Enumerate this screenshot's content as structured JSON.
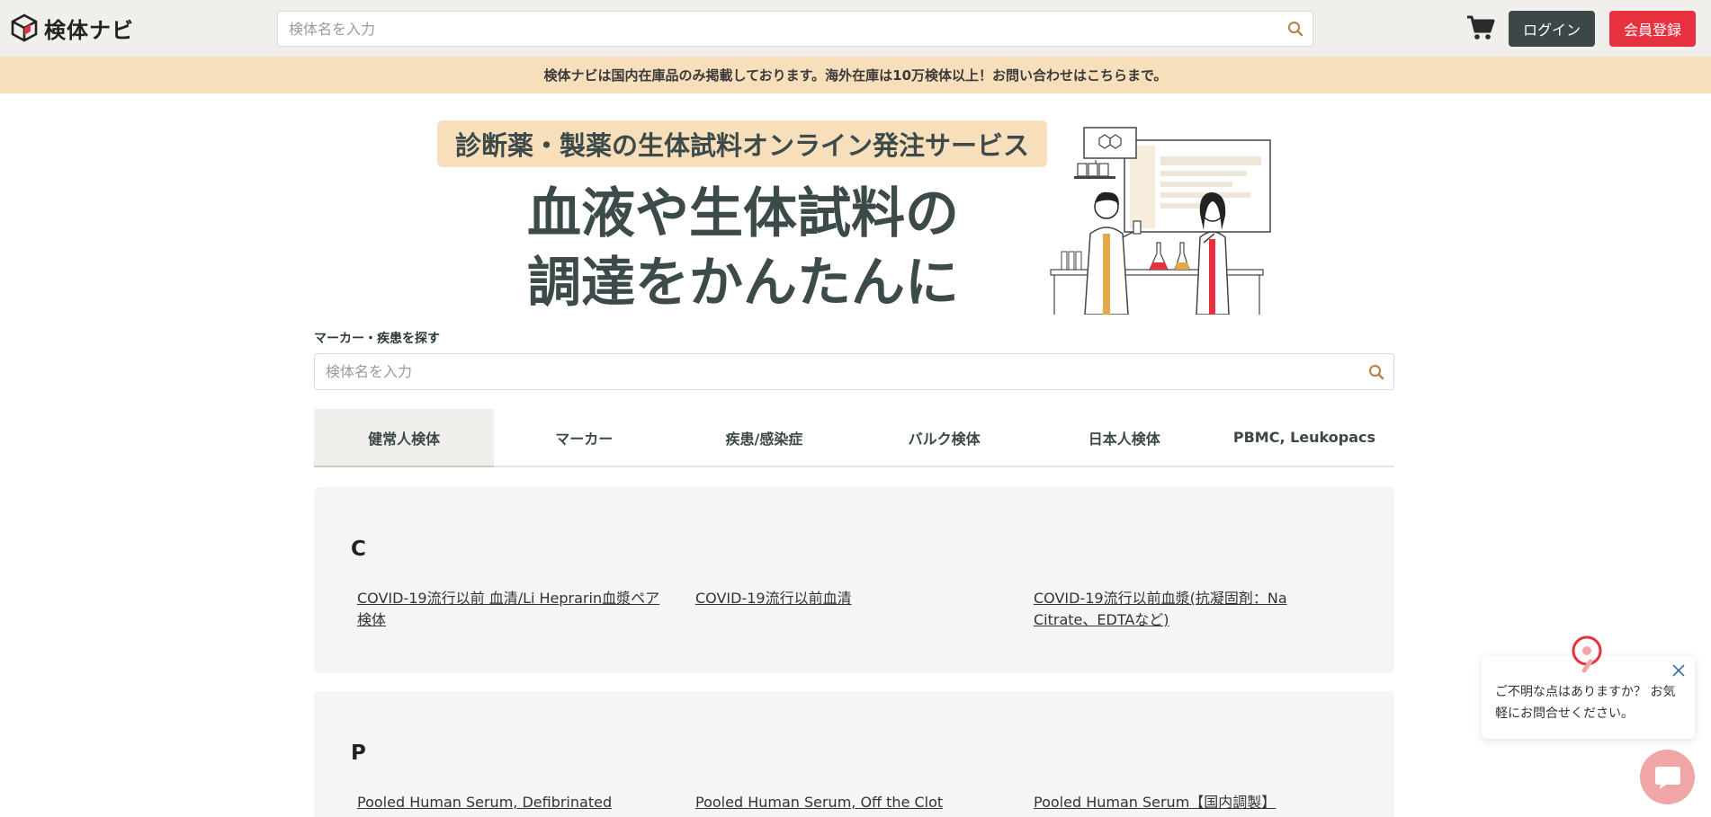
{
  "header": {
    "logo_text": "検体ナビ",
    "search_placeholder": "検体名を入力",
    "login_label": "ログイン",
    "register_label": "会員登録"
  },
  "notice": {
    "text": "検体ナビは国内在庫品のみ掲載しております。海外在庫は10万検体以上！お問い合わせはこちらまで。"
  },
  "hero": {
    "badge": "診断薬・製薬の生体試料オンライン発注サービス",
    "title_line1": "血液や生体試料の",
    "title_line2": "調達をかんたんに"
  },
  "search": {
    "label": "マーカー・疾患を探す",
    "placeholder": "検体名を入力"
  },
  "tabs": [
    {
      "label": "健常人検体",
      "active": true
    },
    {
      "label": "マーカー",
      "active": false
    },
    {
      "label": "疾患/感染症",
      "active": false
    },
    {
      "label": "バルク検体",
      "active": false
    },
    {
      "label": "日本人検体",
      "active": false
    },
    {
      "label": "PBMC, Leukopacs",
      "active": false
    }
  ],
  "sections": [
    {
      "letter": "C",
      "links": [
        "COVID-19流行以前 血清/Li Heprarin血漿ペア検体",
        "COVID-19流行以前血清",
        "COVID-19流行以前血漿(抗凝固剤：Na Citrate、EDTAなど)"
      ]
    },
    {
      "letter": "P",
      "links": [
        "Pooled Human Serum, Defibrinated",
        "Pooled Human Serum, Off the Clot",
        "Pooled Human Serum【国内調製】"
      ]
    }
  ],
  "chat": {
    "message": "ご不明な点はありますか？ お気軽にお問合せください。"
  },
  "colors": {
    "header_bg": "#f0efec",
    "notice_bg": "#f7dfbc",
    "login_bg": "#3d4747",
    "register_bg": "#e8313f",
    "card_bg": "#f5f5f5"
  }
}
